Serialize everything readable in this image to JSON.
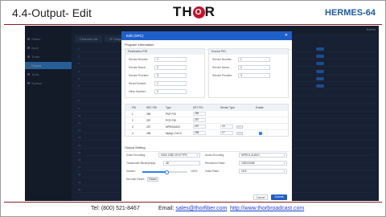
{
  "slide": {
    "title": "4.4-Output- Edit",
    "logo_text_left": "TH",
    "logo_o": "O",
    "logo_text_right": "R",
    "product": "HERMES-64"
  },
  "footer": {
    "tel": "Tel: (800) 521-8467",
    "email_label": "Email:",
    "email": "sales@thorfiber.com",
    "website": "http://www.thorbroadcast.com"
  },
  "app": {
    "sidebar": [
      "Status",
      "Input",
      "Trade",
      "Output",
      "Tools",
      "System"
    ],
    "sidebar_active_index": 3,
    "topbar_right": "Admin",
    "tabs": [
      "Channel List",
      "IP Output"
    ],
    "bg_rows": [
      "1",
      "2",
      "3",
      "4",
      "5",
      "6",
      "7",
      "8",
      "9",
      "10",
      "11",
      "12",
      "13",
      "14",
      "15",
      "16",
      "17",
      "18",
      "19",
      "20"
    ]
  },
  "modal": {
    "title": "Edit (SRC)",
    "program_info": "Program Information",
    "dest_box": "Destination PID",
    "src_box": "Source PID",
    "dest_fields": [
      {
        "label": "Service Number:",
        "value": "1"
      },
      {
        "label": "Service Name:",
        "value": "2"
      },
      {
        "label": "Service Provider:",
        "value": "3"
      },
      {
        "label": "Reset Number:",
        "value": "1"
      },
      {
        "label": "Other Number:",
        "value": "0"
      }
    ],
    "src_fields": [
      {
        "label": "Service Number:",
        "value": "1"
      },
      {
        "label": "Service Name:",
        "value": "2"
      },
      {
        "label": "Service Provider:",
        "value": "3"
      }
    ],
    "pid_headers": [
      "PID",
      "SRC PID",
      "Type",
      "DST PID",
      "Stream Type",
      "Enable"
    ],
    "pid_rows": [
      {
        "pid": "1",
        "src": "256",
        "type": "PMT PID",
        "dst": "256",
        "stream": "",
        "btn": false,
        "enable": false
      },
      {
        "pid": "2",
        "src": "257",
        "type": "PCR PID",
        "dst": "257",
        "stream": "",
        "btn": false,
        "enable": false
      },
      {
        "pid": "3",
        "src": "257",
        "type": "MPEG4/AVC",
        "dst": "257",
        "stream": "16",
        "btn": true,
        "enable": false
      },
      {
        "pid": "4",
        "src": "258",
        "type": "Mpeg1-2 AC3",
        "dst": "258",
        "stream": "17",
        "btn": true,
        "enable": true
      }
    ],
    "output_setting": "Output Setting",
    "video_encoding_label": "Video Encoding:",
    "video_encoding_value": "H264 1080 29.97 FPS",
    "audio_encoding_label": "Audio Encoding:",
    "audio_encoding_value": "MPEG1 AUDIO",
    "bitrate_label": "Transcoder Bitrate(kbps):",
    "bitrate_value": "48",
    "resolution_label": "Resolution Ratio:",
    "resolution_value": "1920X1080",
    "volume_label": "Volume:",
    "volume_value": "100%",
    "volume_level": 0.55,
    "aspect_label": "Video Ratio:",
    "aspect_value": "16:9",
    "decoder_reset_label": "Decoder Reset:",
    "decoder_reset_btn": "Reset",
    "cancel": "Cancel",
    "submit": "Submit"
  }
}
